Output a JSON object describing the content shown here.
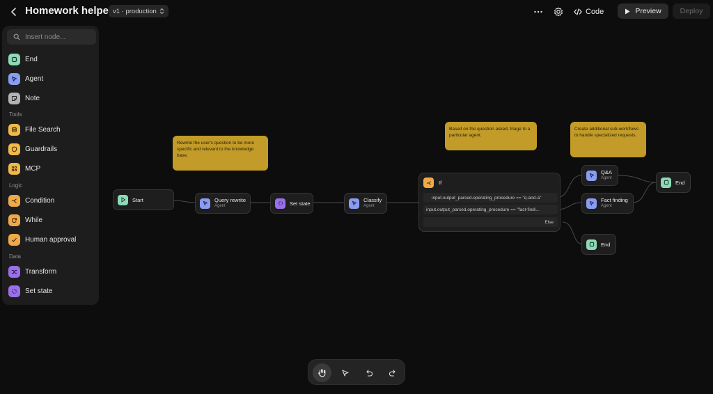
{
  "header": {
    "title": "Homework helper",
    "version": "v1 · production",
    "code_label": "Code",
    "preview_label": "Preview",
    "deploy_label": "Deploy"
  },
  "sidebar": {
    "search_placeholder": "Insert node...",
    "core": [
      {
        "label": "End",
        "icon": "square-icon",
        "color": "#8ed9b8"
      },
      {
        "label": "Agent",
        "icon": "cursor-icon",
        "color": "#8a9cf0"
      },
      {
        "label": "Note",
        "icon": "note-icon",
        "color": "#b3b3b3"
      }
    ],
    "sections": {
      "tools": "Tools",
      "logic": "Logic",
      "data": "Data"
    },
    "tools": [
      {
        "label": "File Search",
        "icon": "database-icon",
        "color": "#f0b94a"
      },
      {
        "label": "Guardrails",
        "icon": "shield-icon",
        "color": "#f0b94a"
      },
      {
        "label": "MCP",
        "icon": "mcp-icon",
        "color": "#f0b94a"
      }
    ],
    "logic": [
      {
        "label": "Condition",
        "icon": "branch-icon",
        "color": "#f0a948"
      },
      {
        "label": "While",
        "icon": "loop-icon",
        "color": "#f0a948"
      },
      {
        "label": "Human approval",
        "icon": "approval-icon",
        "color": "#f0a948"
      }
    ],
    "data": [
      {
        "label": "Transform",
        "icon": "shuffle-icon",
        "color": "#9a70e8"
      },
      {
        "label": "Set state",
        "icon": "state-icon",
        "color": "#9a70e8"
      }
    ]
  },
  "canvas": {
    "notes": [
      "Rewrite the user's question to be more specific and relevant to the knowledge base.",
      "Based on the question asked, triage to a particular agent.",
      "Create additional sub-workflows to handle specialized requests."
    ],
    "nodes": {
      "start": {
        "label": "Start"
      },
      "query_rewrite": {
        "label": "Query rewrite",
        "sub": "Agent"
      },
      "set_state": {
        "label": "Set state"
      },
      "classify": {
        "label": "Classify",
        "sub": "Agent"
      },
      "if": {
        "label": "If",
        "conditions": [
          "input.output_parsed.operating_procedure == \"q-and-a\"",
          "input.output_parsed.operating_procedure == \"fact-findi..."
        ],
        "else_label": "Else"
      },
      "qa": {
        "label": "Q&A",
        "sub": "Agent"
      },
      "fact_finding": {
        "label": "Fact finding",
        "sub": "Agent"
      },
      "end_right": {
        "label": "End"
      },
      "end_bottom": {
        "label": "End"
      }
    }
  },
  "toolbar": {
    "tools": [
      "hand-icon",
      "pointer-icon",
      "undo-icon",
      "redo-icon"
    ],
    "active": "hand-icon"
  },
  "colors": {
    "background": "#0d0d0d",
    "note": "#c29b28",
    "agent": "#8a9cf0",
    "end": "#8ed9b8",
    "logic": "#f0a948",
    "data": "#9a70e8"
  }
}
